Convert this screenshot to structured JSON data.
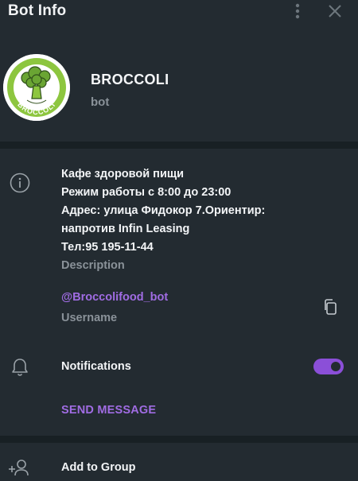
{
  "header": {
    "title": "Bot Info",
    "more_icon": "vertical-dots-icon",
    "close_icon": "close-icon"
  },
  "profile": {
    "name": "BROCCOLI",
    "subtitle": "bot",
    "avatar_text": "BROCCOLI"
  },
  "info": {
    "about_lines": [
      "Кафе здоровой пищи",
      "Режим работы с 8:00 до 23:00",
      "Адрес: улица Фидокор 7.Ориентир:",
      "напротив Infin Leasing",
      "Тел:95 195-11-44"
    ],
    "about_label": "Description",
    "username": "@Broccolifood_bot",
    "username_label": "Username"
  },
  "notifications": {
    "label": "Notifications",
    "enabled": true
  },
  "actions": {
    "send_message": "SEND MESSAGE",
    "add_to_group": "Add to Group"
  },
  "colors": {
    "background": "#232b31",
    "divider": "#182024",
    "accent": "#8b4fd8",
    "link": "#a06ce3",
    "secondary_text": "#8a9299",
    "avatar_green": "#8dc63f"
  }
}
